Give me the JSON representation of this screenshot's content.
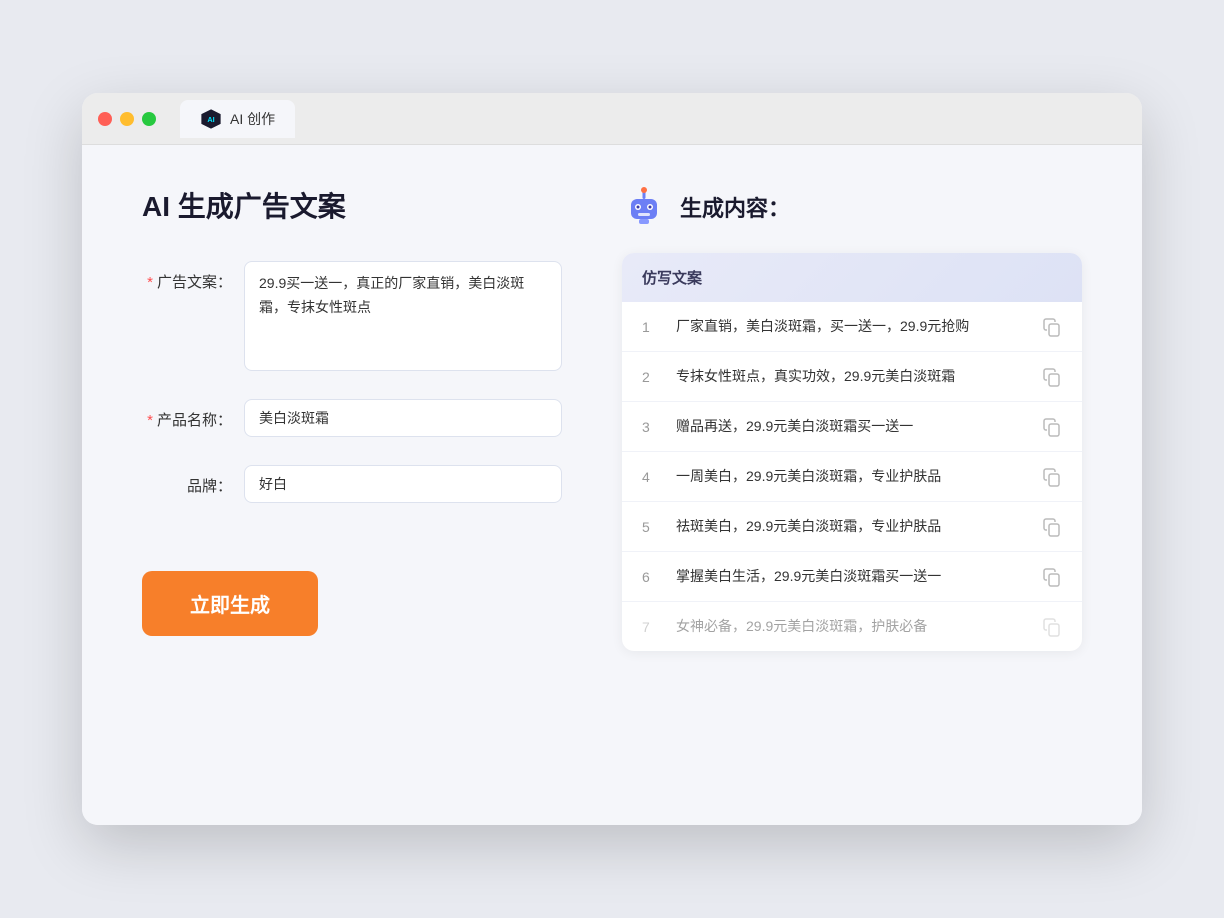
{
  "browser": {
    "tab_label": "AI 创作"
  },
  "page": {
    "title": "AI 生成广告文案",
    "result_title": "生成内容："
  },
  "form": {
    "ad_copy_label": "广告文案：",
    "ad_copy_required": "*",
    "ad_copy_value": "29.9买一送一，真正的厂家直销，美白淡斑霜，专抹女性斑点",
    "product_name_label": "产品名称：",
    "product_name_required": "*",
    "product_name_value": "美白淡斑霜",
    "brand_label": "品牌：",
    "brand_value": "好白",
    "generate_btn": "立即生成"
  },
  "results": {
    "table_header": "仿写文案",
    "items": [
      {
        "num": "1",
        "text": "厂家直销，美白淡斑霜，买一送一，29.9元抢购",
        "dimmed": false
      },
      {
        "num": "2",
        "text": "专抹女性斑点，真实功效，29.9元美白淡斑霜",
        "dimmed": false
      },
      {
        "num": "3",
        "text": "赠品再送，29.9元美白淡斑霜买一送一",
        "dimmed": false
      },
      {
        "num": "4",
        "text": "一周美白，29.9元美白淡斑霜，专业护肤品",
        "dimmed": false
      },
      {
        "num": "5",
        "text": "祛斑美白，29.9元美白淡斑霜，专业护肤品",
        "dimmed": false
      },
      {
        "num": "6",
        "text": "掌握美白生活，29.9元美白淡斑霜买一送一",
        "dimmed": false
      },
      {
        "num": "7",
        "text": "女神必备，29.9元美白淡斑霜，护肤必备",
        "dimmed": true
      }
    ]
  }
}
